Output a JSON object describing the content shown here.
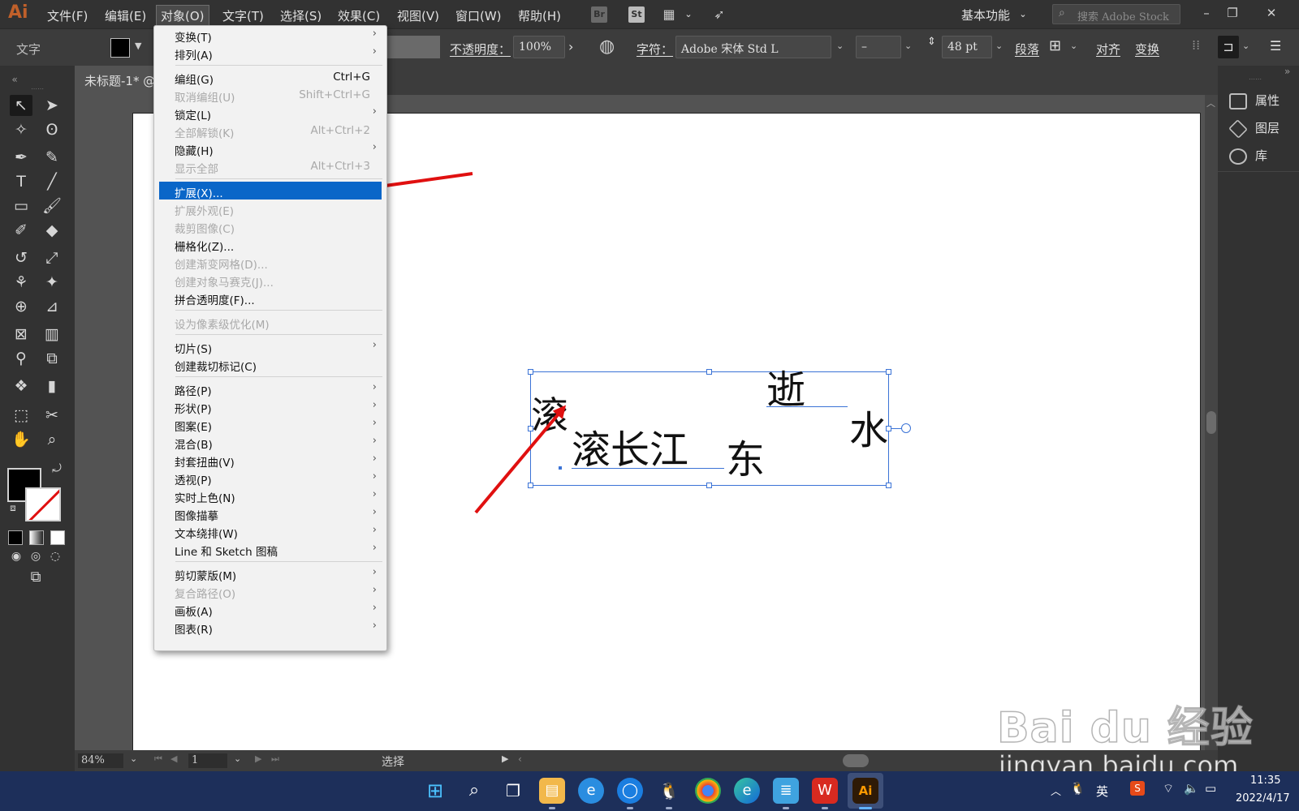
{
  "app": {
    "logo": "Ai"
  },
  "menubar": {
    "items": [
      "文件(F)",
      "编辑(E)",
      "对象(O)",
      "文字(T)",
      "选择(S)",
      "效果(C)",
      "视图(V)",
      "窗口(W)",
      "帮助(H)"
    ],
    "active_item": "对象(O)",
    "bridge_icon": "Br",
    "stock_icon": "St",
    "workspace": "基本功能",
    "search_placeholder": "搜索 Adobe Stock"
  },
  "controlbar": {
    "tool_label": "文字",
    "opacity_label": "不透明度：",
    "opacity_value": "100%",
    "character_label": "字符：",
    "font_family": "Adobe 宋体 Std L",
    "font_style": "–",
    "font_size": "48 pt",
    "paragraph_label": "段落",
    "align_label": "对齐",
    "transform_label": "变换"
  },
  "document": {
    "tab_title": "未标题-1* @"
  },
  "object_menu": {
    "items": [
      {
        "label": "变换(T)",
        "shortcut": "",
        "submenu": true,
        "disabled": false
      },
      {
        "label": "排列(A)",
        "shortcut": "",
        "submenu": true,
        "disabled": false
      },
      {
        "label": "编组(G)",
        "shortcut": "Ctrl+G",
        "submenu": false,
        "disabled": false
      },
      {
        "label": "取消编组(U)",
        "shortcut": "Shift+Ctrl+G",
        "submenu": false,
        "disabled": true
      },
      {
        "label": "锁定(L)",
        "shortcut": "",
        "submenu": true,
        "disabled": false
      },
      {
        "label": "全部解锁(K)",
        "shortcut": "Alt+Ctrl+2",
        "submenu": false,
        "disabled": true
      },
      {
        "label": "隐藏(H)",
        "shortcut": "",
        "submenu": true,
        "disabled": false
      },
      {
        "label": "显示全部",
        "shortcut": "Alt+Ctrl+3",
        "submenu": false,
        "disabled": true
      },
      {
        "label": "扩展(X)...",
        "shortcut": "",
        "submenu": false,
        "disabled": false,
        "highlighted": true
      },
      {
        "label": "扩展外观(E)",
        "shortcut": "",
        "submenu": false,
        "disabled": true
      },
      {
        "label": "裁剪图像(C)",
        "shortcut": "",
        "submenu": false,
        "disabled": true
      },
      {
        "label": "栅格化(Z)...",
        "shortcut": "",
        "submenu": false,
        "disabled": false
      },
      {
        "label": "创建渐变网格(D)...",
        "shortcut": "",
        "submenu": false,
        "disabled": true
      },
      {
        "label": "创建对象马赛克(J)...",
        "shortcut": "",
        "submenu": false,
        "disabled": true
      },
      {
        "label": "拼合透明度(F)...",
        "shortcut": "",
        "submenu": false,
        "disabled": false
      },
      {
        "label": "设为像素级优化(M)",
        "shortcut": "",
        "submenu": false,
        "disabled": true
      },
      {
        "label": "切片(S)",
        "shortcut": "",
        "submenu": true,
        "disabled": false
      },
      {
        "label": "创建裁切标记(C)",
        "shortcut": "",
        "submenu": false,
        "disabled": false
      },
      {
        "label": "路径(P)",
        "shortcut": "",
        "submenu": true,
        "disabled": false
      },
      {
        "label": "形状(P)",
        "shortcut": "",
        "submenu": true,
        "disabled": false
      },
      {
        "label": "图案(E)",
        "shortcut": "",
        "submenu": true,
        "disabled": false
      },
      {
        "label": "混合(B)",
        "shortcut": "",
        "submenu": true,
        "disabled": false
      },
      {
        "label": "封套扭曲(V)",
        "shortcut": "",
        "submenu": true,
        "disabled": false
      },
      {
        "label": "透视(P)",
        "shortcut": "",
        "submenu": true,
        "disabled": false
      },
      {
        "label": "实时上色(N)",
        "shortcut": "",
        "submenu": true,
        "disabled": false
      },
      {
        "label": "图像描摹",
        "shortcut": "",
        "submenu": true,
        "disabled": false
      },
      {
        "label": "文本绕排(W)",
        "shortcut": "",
        "submenu": true,
        "disabled": false
      },
      {
        "label": "Line 和 Sketch 图稿",
        "shortcut": "",
        "submenu": true,
        "disabled": false
      },
      {
        "label": "剪切蒙版(M)",
        "shortcut": "",
        "submenu": true,
        "disabled": false
      },
      {
        "label": "复合路径(O)",
        "shortcut": "",
        "submenu": true,
        "disabled": true
      },
      {
        "label": "画板(A)",
        "shortcut": "",
        "submenu": true,
        "disabled": false
      },
      {
        "label": "图表(R)",
        "shortcut": "",
        "submenu": true,
        "disabled": false
      }
    ]
  },
  "right_panel": {
    "items": [
      "属性",
      "图层",
      "库"
    ]
  },
  "canvas_text": {
    "glyphs": [
      {
        "char": "滚"
      },
      {
        "char": "滚长江"
      },
      {
        "char": "东"
      },
      {
        "char": "逝"
      },
      {
        "char": "水"
      }
    ]
  },
  "statusbar": {
    "zoom": "84%",
    "artboard_number": "1",
    "tool_status": "选择"
  },
  "taskbar": {
    "ime": "英",
    "time": "11:35",
    "date": "2022/4/17"
  },
  "watermark": {
    "logo": "Bai du 经验",
    "url": "jingyan.baidu.com"
  },
  "colors": {
    "menu_highlight": "#0a66c8",
    "selection_blue": "#3b73d6",
    "annotation_arrow": "#e01010",
    "illustrator_orange": "#c0602a"
  }
}
